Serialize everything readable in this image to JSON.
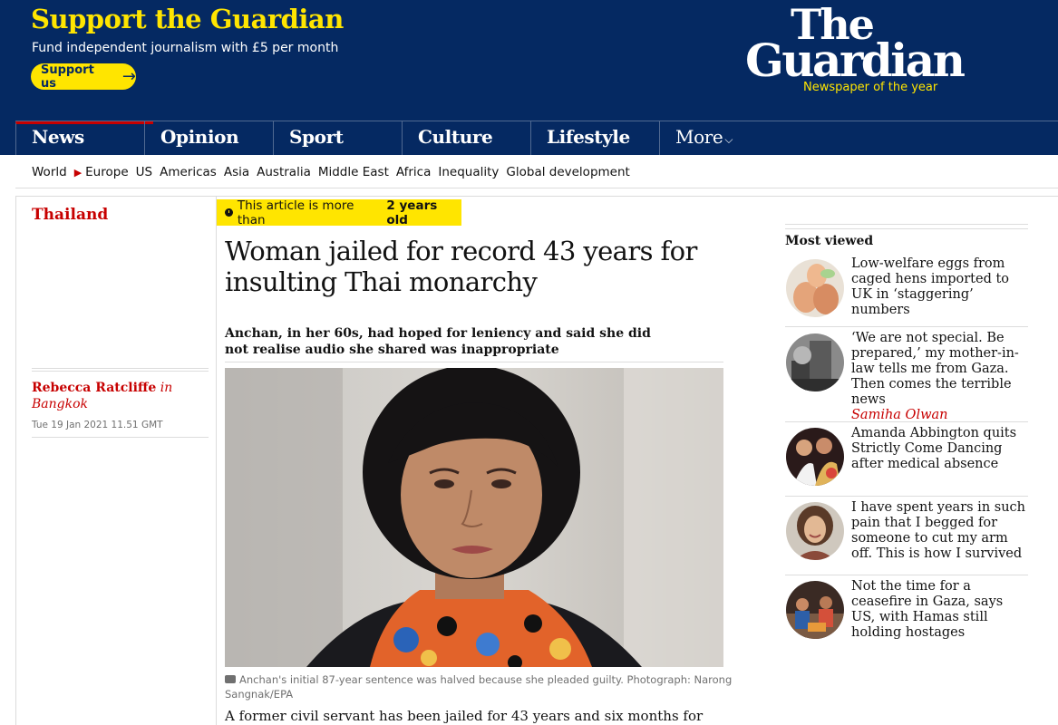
{
  "support": {
    "title": "Support the Guardian",
    "subtitle": "Fund independent journalism with £5 per month",
    "button_label": "Support us",
    "arrow": "→"
  },
  "logo": {
    "line1": "The",
    "line2": "Guardian",
    "tagline": "Newspaper of the year"
  },
  "pillars": [
    {
      "label": "News"
    },
    {
      "label": "Opinion"
    },
    {
      "label": "Sport"
    },
    {
      "label": "Culture"
    },
    {
      "label": "Lifestyle"
    },
    {
      "label": "More"
    }
  ],
  "subnav": {
    "items": [
      "World",
      "Europe",
      "US",
      "Americas",
      "Asia",
      "Australia",
      "Middle East",
      "Africa",
      "Inequality",
      "Global development"
    ]
  },
  "article": {
    "section": "Thailand",
    "age_prefix": "This article is more than",
    "age_value": "2 years old",
    "headline": "Woman jailed for record 43 years for insulting Thai monarchy",
    "standfirst": "Anchan, in her 60s, had hoped for leniency and said she did not realise audio she shared was inappropriate",
    "author": "Rebecca Ratcliffe",
    "author_location": "in Bangkok",
    "date": "Tue 19 Jan 2021 11.51 GMT",
    "caption": "Anchan's initial 87-year sentence was halved because she pleaded guilty. Photograph: Narong Sangnak/EPA",
    "body_start": "A former civil servant has been jailed for 43 years and six months for"
  },
  "most_viewed": {
    "title": "Most viewed",
    "items": [
      {
        "headline": "Low-welfare eggs from caged hens imported to UK in ‘staggering’ numbers",
        "kicker": ""
      },
      {
        "headline": "‘We are not special. Be prepared,’ my mother-in-law tells me from Gaza. Then comes the terrible news",
        "kicker": "Samiha Olwan"
      },
      {
        "headline": "Amanda Abbington quits Strictly Come Dancing after medical absence",
        "kicker": ""
      },
      {
        "headline": "I have spent years in such pain that I begged for someone to cut my arm off. This is how I survived",
        "kicker": ""
      },
      {
        "headline": "Not the time for a ceasefire in Gaza, says US, with Hamas still holding hostages",
        "kicker": ""
      }
    ]
  },
  "icons": [
    "arrow-right-icon",
    "chevron-down-icon",
    "triangle-right-icon",
    "clock-icon",
    "camera-icon"
  ],
  "colors": {
    "brand_blue": "#052962",
    "support_yellow": "#ffe500",
    "news_red": "#c70000",
    "pillar_rule": "#506991"
  }
}
